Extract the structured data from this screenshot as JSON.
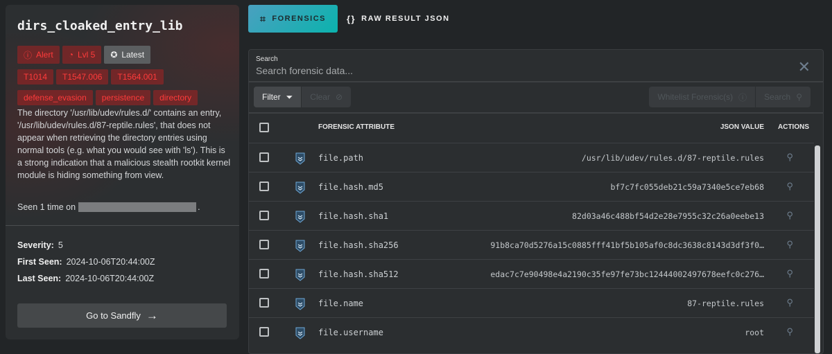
{
  "card": {
    "title": "dirs_cloaked_entry_lib",
    "status_badges": [
      {
        "label": "Alert",
        "icon": "alert-circle-icon"
      },
      {
        "label": "Lvl 5",
        "icon": "gauge-icon"
      },
      {
        "label": "Latest",
        "icon": "badge-alert-icon"
      }
    ],
    "tags": [
      "T1014",
      "T1547.006",
      "T1564.001",
      "defense_evasion",
      "persistence",
      "directory"
    ],
    "description": "The directory '/usr/lib/udev/rules.d/' contains an entry, '/usr/lib/udev/rules.d/87-reptile.rules', that does not appear when retrieving the directory entries using normal tools (e.g. what you would see with 'ls'). This is a strong indication that a malicious stealth rootkit kernel module is hiding something from view.",
    "seen_prefix": "Seen 1 time on",
    "seen_suffix": ".",
    "severity_label": "Severity:",
    "severity": "5",
    "first_seen_label": "First Seen:",
    "first_seen": "2024-10-06T20:44:00Z",
    "last_seen_label": "Last Seen:",
    "last_seen": "2024-10-06T20:44:00Z",
    "go_button": "Go to Sandfly"
  },
  "tabs": [
    {
      "label": "FORENSICS",
      "active": true
    },
    {
      "label": "RAW RESULT JSON",
      "active": false
    }
  ],
  "search": {
    "label": "Search",
    "placeholder": "Search forensic data..."
  },
  "toolbar": {
    "filter": "Filter",
    "clear": "Clear",
    "whitelist": "Whitelist Forensic(s)",
    "search": "Search"
  },
  "table": {
    "headers": {
      "attribute": "FORENSIC ATTRIBUTE",
      "value": "JSON VALUE",
      "actions": "ACTIONS"
    },
    "rows": [
      {
        "attribute": "file.path",
        "value": "/usr/lib/udev/rules.d/87-reptile.rules"
      },
      {
        "attribute": "file.hash.md5",
        "value": "bf7c7fc055deb21c59a7340e5ce7eb68"
      },
      {
        "attribute": "file.hash.sha1",
        "value": "82d03a46c488bf54d2e28e7955c32c26a0eebe13"
      },
      {
        "attribute": "file.hash.sha256",
        "value": "91b8ca70d5276a15c0885fff41bf5b105af0c8dc3638c8143d3df3f0…"
      },
      {
        "attribute": "file.hash.sha512",
        "value": "edac7c7e90498e4a2190c35fe97fe73bc12444002497678eefc0c276…"
      },
      {
        "attribute": "file.name",
        "value": "87-reptile.rules"
      },
      {
        "attribute": "file.username",
        "value": "root"
      }
    ]
  },
  "colors": {
    "accent": "#0bb3ad",
    "danger": "#ff3b3b"
  }
}
